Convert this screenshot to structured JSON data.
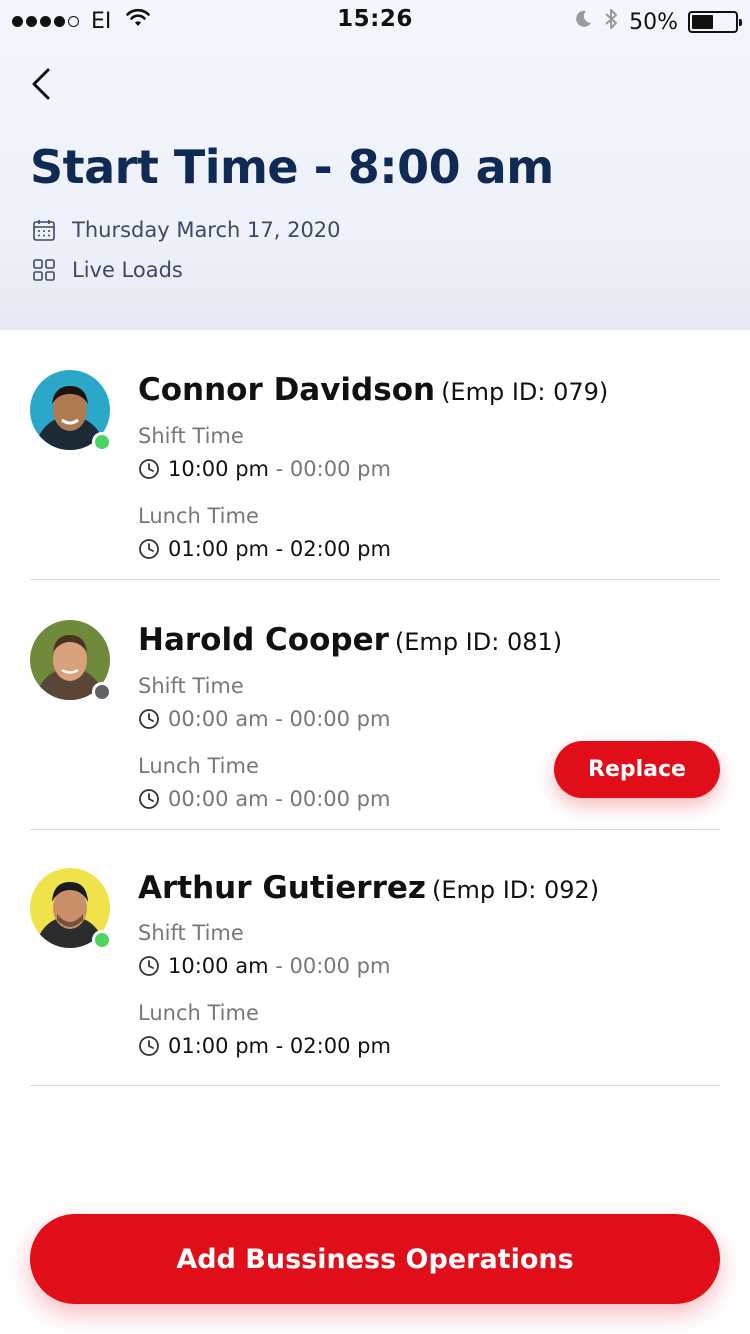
{
  "status_bar": {
    "carrier": "EI",
    "time": "15:26",
    "battery": "50%",
    "battery_level": 0.5
  },
  "header": {
    "back_icon": "chevron-left-icon",
    "title": "Start Time - 8:00 am",
    "date": "Thursday March 17, 2020",
    "load_type": "Live Loads"
  },
  "employees": [
    {
      "name": "Connor Davidson",
      "emp_id": "(Emp ID: 079)",
      "status": "online",
      "shift_label": "Shift Time",
      "shift_start": "10:00 pm",
      "shift_end": "00:00 pm",
      "lunch_label": "Lunch Time",
      "lunch_start": "01:00 pm",
      "lunch_end": "02:00 pm"
    },
    {
      "name": "Harold Cooper",
      "emp_id": "(Emp ID: 081)",
      "status": "offline",
      "shift_label": "Shift Time",
      "shift_start": "00:00 am",
      "shift_end": "00:00 pm",
      "lunch_label": "Lunch Time",
      "lunch_start": "00:00 am",
      "lunch_end": "00:00 pm",
      "action_label": "Replace"
    },
    {
      "name": "Arthur Gutierrez",
      "emp_id": "(Emp ID: 092)",
      "status": "online",
      "shift_label": "Shift Time",
      "shift_start": "10:00 am",
      "shift_end": "00:00 pm",
      "lunch_label": "Lunch Time",
      "lunch_start": "01:00 pm",
      "lunch_end": "02:00 pm"
    }
  ],
  "primary_action": "Add Bussiness Operations",
  "colors": {
    "accent": "#e10e1a",
    "title": "#0f2a55",
    "online": "#4bd460",
    "offline": "#5f6368"
  }
}
